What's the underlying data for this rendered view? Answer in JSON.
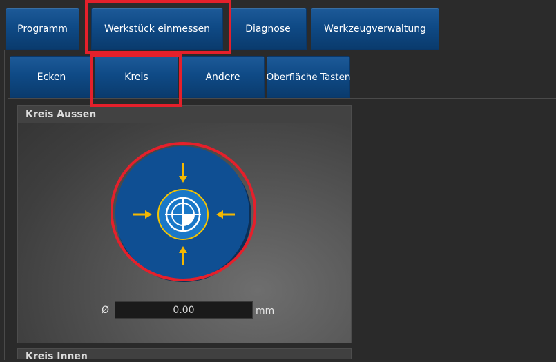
{
  "main_tabs": [
    {
      "label": "Programm"
    },
    {
      "label": "Werkstück einmessen"
    },
    {
      "label": "Diagnose"
    },
    {
      "label": "Werkzeugverwaltung"
    }
  ],
  "sub_tabs": [
    {
      "label": "Ecken"
    },
    {
      "label": "Kreis"
    },
    {
      "label": "Andere"
    },
    {
      "label": "Oberfläche Tasten"
    }
  ],
  "panel_outer": {
    "title": "Kreis Aussen",
    "diameter_symbol": "Ø",
    "diameter_value": "0.00",
    "unit": "mm"
  },
  "panel_inner": {
    "title": "Kreis Innen"
  },
  "colors": {
    "tab_blue": "#0f4a86",
    "highlight_red": "#e5202b",
    "arrow_yellow": "#f5b800"
  }
}
